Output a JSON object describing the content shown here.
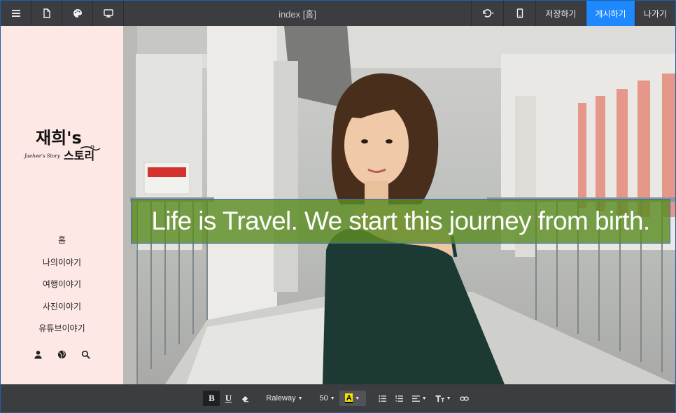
{
  "topbar": {
    "title": "index [홈]",
    "save_label": "저장하기",
    "publish_label": "게시하기",
    "exit_label": "나가기",
    "icons": [
      "menu-icon",
      "page-icon",
      "palette-icon",
      "desktop-icon",
      "undo-icon",
      "mobile-icon"
    ]
  },
  "sidebar": {
    "logo_text_main": "재희's",
    "logo_text_sub": "스토리",
    "logo_script": "Jaehee's Story",
    "nav": [
      "홈",
      "나의이야기",
      "여행이야기",
      "사진이야기",
      "유튜브이야기"
    ],
    "icons": [
      "user-icon",
      "globe-icon",
      "search-icon"
    ]
  },
  "hero": {
    "headline": "Life is Travel. We start this journey from birth.",
    "overlay_color": "#5c8c22"
  },
  "format_toolbar": {
    "bold": "B",
    "underline": "U",
    "font": "Raleway",
    "size": "50",
    "color_sample": "A"
  },
  "colors": {
    "accent": "#1e88ff",
    "sidebar_bg": "#fde8e6",
    "toolbar_bg": "#3c3d40"
  }
}
